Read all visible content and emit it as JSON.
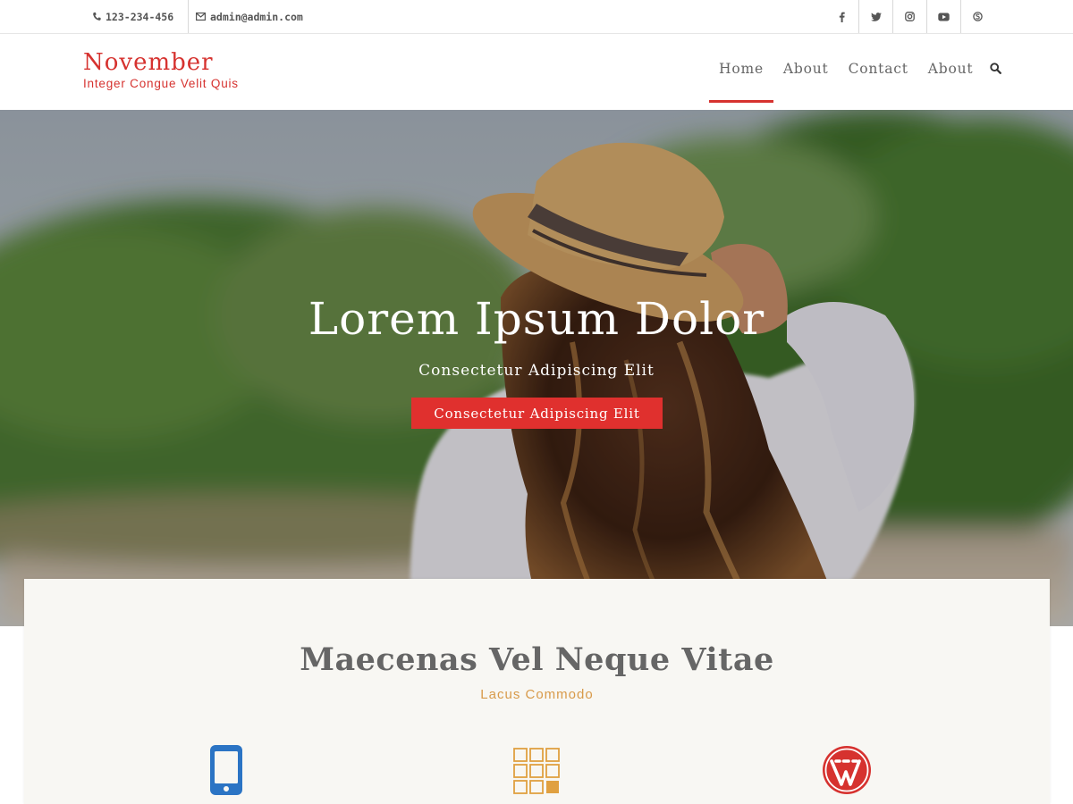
{
  "topbar": {
    "phone": "123-234-456",
    "email": "admin@admin.com",
    "social_icons": [
      "facebook-icon",
      "twitter-icon",
      "instagram-icon",
      "youtube-icon",
      "skype-icon"
    ]
  },
  "header": {
    "site_title": "November",
    "tagline": "Integer Congue Velit Quis",
    "nav": [
      {
        "label": "Home",
        "active": true
      },
      {
        "label": "About",
        "active": false
      },
      {
        "label": "Contact",
        "active": false
      },
      {
        "label": "About",
        "active": false
      }
    ],
    "search_icon": "search-icon"
  },
  "hero": {
    "title": "Lorem Ipsum Dolor",
    "subtitle": "Consectetur Adipiscing Elit",
    "button_label": "Consectetur Adipiscing Elit"
  },
  "features": {
    "title": "Maecenas Vel Neque Vitae",
    "subtitle": "Lacus Commodo",
    "icons": [
      "mobile-phone-icon",
      "grid-icon",
      "wordpress-icon"
    ]
  },
  "colors": {
    "accent": "#e0302e",
    "brand": "#d6322f",
    "subtitle_gold": "#d89a4a",
    "mobile_blue": "#2b74c4",
    "grid_gold": "#e0a040"
  }
}
